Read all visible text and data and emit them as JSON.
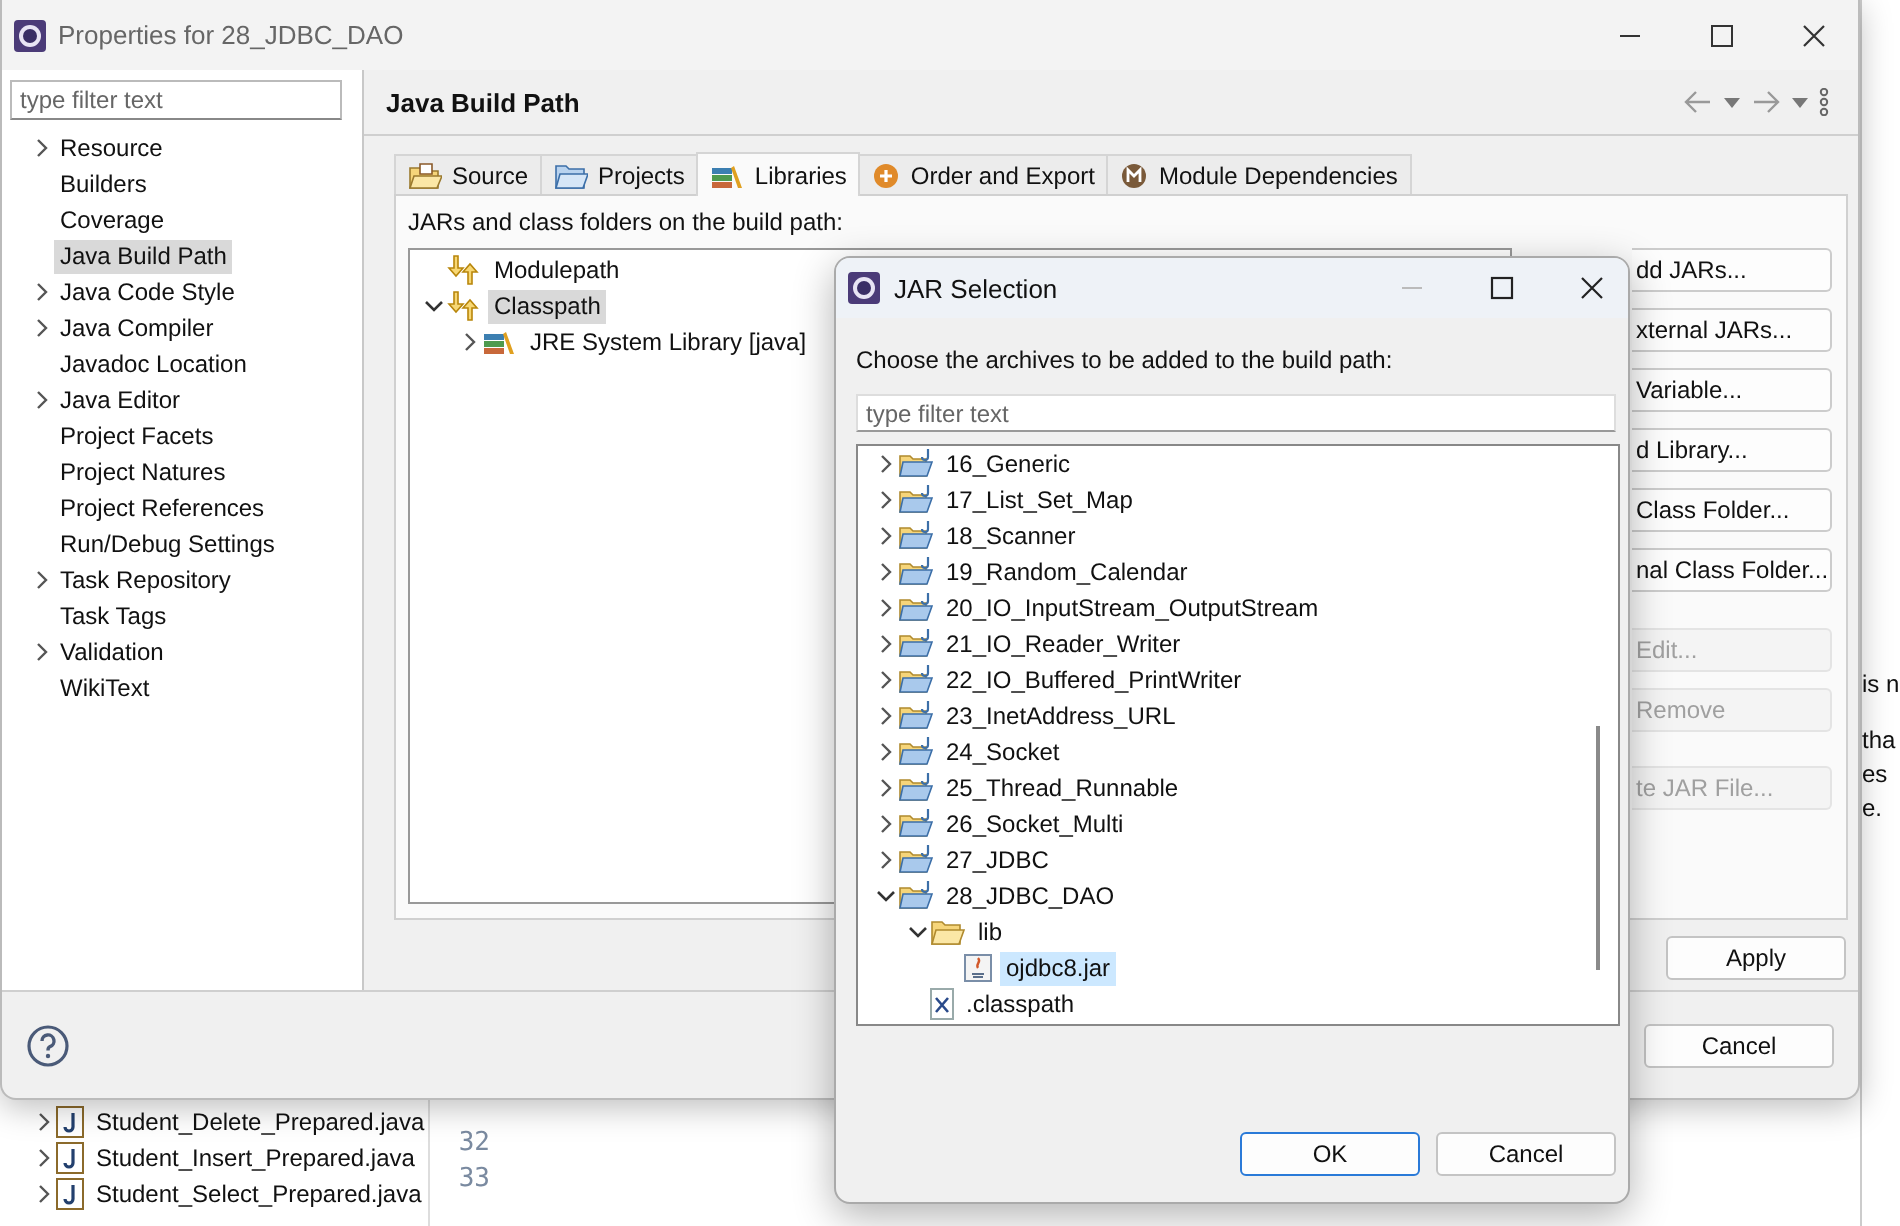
{
  "background_ide": {
    "package_explorer": [
      {
        "label": "Student_Delete_Prepared.java",
        "expandable": true,
        "expanded": false
      },
      {
        "label": "Student_Insert_Prepared.java",
        "expandable": true,
        "expanded": false
      },
      {
        "label": "Student_Select_Prepared.java",
        "expandable": true,
        "expanded": false
      }
    ],
    "line_numbers": [
      "32",
      "33"
    ],
    "side_panel_text": [
      "is n",
      "tha",
      "es",
      "e."
    ]
  },
  "properties_window": {
    "title": "Properties for 28_JDBC_DAO",
    "filter": {
      "placeholder": "type filter text"
    },
    "sidebar": {
      "items": [
        {
          "label": "Resource",
          "expandable": true,
          "expanded": false,
          "selected": false
        },
        {
          "label": "Builders",
          "expandable": false,
          "selected": false
        },
        {
          "label": "Coverage",
          "expandable": false,
          "selected": false
        },
        {
          "label": "Java Build Path",
          "expandable": false,
          "selected": true
        },
        {
          "label": "Java Code Style",
          "expandable": true,
          "expanded": false,
          "selected": false
        },
        {
          "label": "Java Compiler",
          "expandable": true,
          "expanded": false,
          "selected": false
        },
        {
          "label": "Javadoc Location",
          "expandable": false,
          "selected": false
        },
        {
          "label": "Java Editor",
          "expandable": true,
          "expanded": false,
          "selected": false
        },
        {
          "label": "Project Facets",
          "expandable": false,
          "selected": false
        },
        {
          "label": "Project Natures",
          "expandable": false,
          "selected": false
        },
        {
          "label": "Project References",
          "expandable": false,
          "selected": false
        },
        {
          "label": "Run/Debug Settings",
          "expandable": false,
          "selected": false
        },
        {
          "label": "Task Repository",
          "expandable": true,
          "expanded": false,
          "selected": false
        },
        {
          "label": "Task Tags",
          "expandable": false,
          "selected": false
        },
        {
          "label": "Validation",
          "expandable": true,
          "expanded": false,
          "selected": false
        },
        {
          "label": "WikiText",
          "expandable": false,
          "selected": false
        }
      ]
    },
    "page_title": "Java Build Path",
    "tabs": [
      {
        "label": "Source",
        "kind": "source",
        "selected": false
      },
      {
        "label": "Projects",
        "kind": "projects",
        "selected": false
      },
      {
        "label": "Libraries",
        "kind": "libraries",
        "selected": true
      },
      {
        "label": "Order and Export",
        "kind": "order",
        "selected": false
      },
      {
        "label": "Module Dependencies",
        "kind": "modules",
        "selected": false
      }
    ],
    "build_path_label": "JARs and class folders on the build path:",
    "build_path_tree": [
      {
        "label": "Modulepath",
        "kind": "container",
        "expandable": false,
        "selected": false
      },
      {
        "label": "Classpath",
        "kind": "container",
        "expandable": true,
        "expanded": true,
        "selected": true,
        "children": [
          {
            "label": "JRE System Library [java]",
            "kind": "library",
            "expandable": true,
            "expanded": false,
            "selected": false
          }
        ]
      }
    ],
    "side_buttons": [
      {
        "label": "dd JARs...",
        "disabled": false
      },
      {
        "label": "xternal JARs...",
        "disabled": false
      },
      {
        "label": "Variable...",
        "disabled": false
      },
      {
        "label": "d Library...",
        "disabled": false
      },
      {
        "label": "Class Folder...",
        "disabled": false
      },
      {
        "label": "nal Class Folder...",
        "disabled": false
      },
      {
        "label": "Edit...",
        "disabled": true
      },
      {
        "label": "Remove",
        "disabled": true
      },
      {
        "label": "te JAR File...",
        "disabled": true
      }
    ],
    "apply_button": "Apply",
    "cancel_button": "Cancel"
  },
  "jar_dialog": {
    "title": "JAR Selection",
    "instruction": "Choose the archives to be added to the build path:",
    "filter": {
      "placeholder": "type filter text"
    },
    "tree": [
      {
        "label": "16_Generic",
        "kind": "project",
        "expandable": true,
        "expanded": false,
        "selected": false
      },
      {
        "label": "17_List_Set_Map",
        "kind": "project",
        "expandable": true,
        "expanded": false,
        "selected": false
      },
      {
        "label": "18_Scanner",
        "kind": "project",
        "expandable": true,
        "expanded": false,
        "selected": false
      },
      {
        "label": "19_Random_Calendar",
        "kind": "project",
        "expandable": true,
        "expanded": false,
        "selected": false
      },
      {
        "label": "20_IO_InputStream_OutputStream",
        "kind": "project",
        "expandable": true,
        "expanded": false,
        "selected": false
      },
      {
        "label": "21_IO_Reader_Writer",
        "kind": "project",
        "expandable": true,
        "expanded": false,
        "selected": false
      },
      {
        "label": "22_IO_Buffered_PrintWriter",
        "kind": "project",
        "expandable": true,
        "expanded": false,
        "selected": false
      },
      {
        "label": "23_InetAddress_URL",
        "kind": "project",
        "expandable": true,
        "expanded": false,
        "selected": false
      },
      {
        "label": "24_Socket",
        "kind": "project",
        "expandable": true,
        "expanded": false,
        "selected": false
      },
      {
        "label": "25_Thread_Runnable",
        "kind": "project",
        "expandable": true,
        "expanded": false,
        "selected": false
      },
      {
        "label": "26_Socket_Multi",
        "kind": "project",
        "expandable": true,
        "expanded": false,
        "selected": false
      },
      {
        "label": "27_JDBC",
        "kind": "project",
        "expandable": true,
        "expanded": false,
        "selected": false
      },
      {
        "label": "28_JDBC_DAO",
        "kind": "project",
        "expandable": true,
        "expanded": true,
        "selected": false,
        "children": [
          {
            "label": "lib",
            "kind": "folder",
            "expandable": true,
            "expanded": true,
            "selected": false,
            "children": [
              {
                "label": "ojdbc8.jar",
                "kind": "jar",
                "expandable": false,
                "selected": true
              }
            ]
          },
          {
            "label": ".classpath",
            "kind": "xml",
            "expandable": false,
            "selected": false
          }
        ]
      }
    ],
    "ok_button": "OK",
    "cancel_button": "Cancel"
  }
}
